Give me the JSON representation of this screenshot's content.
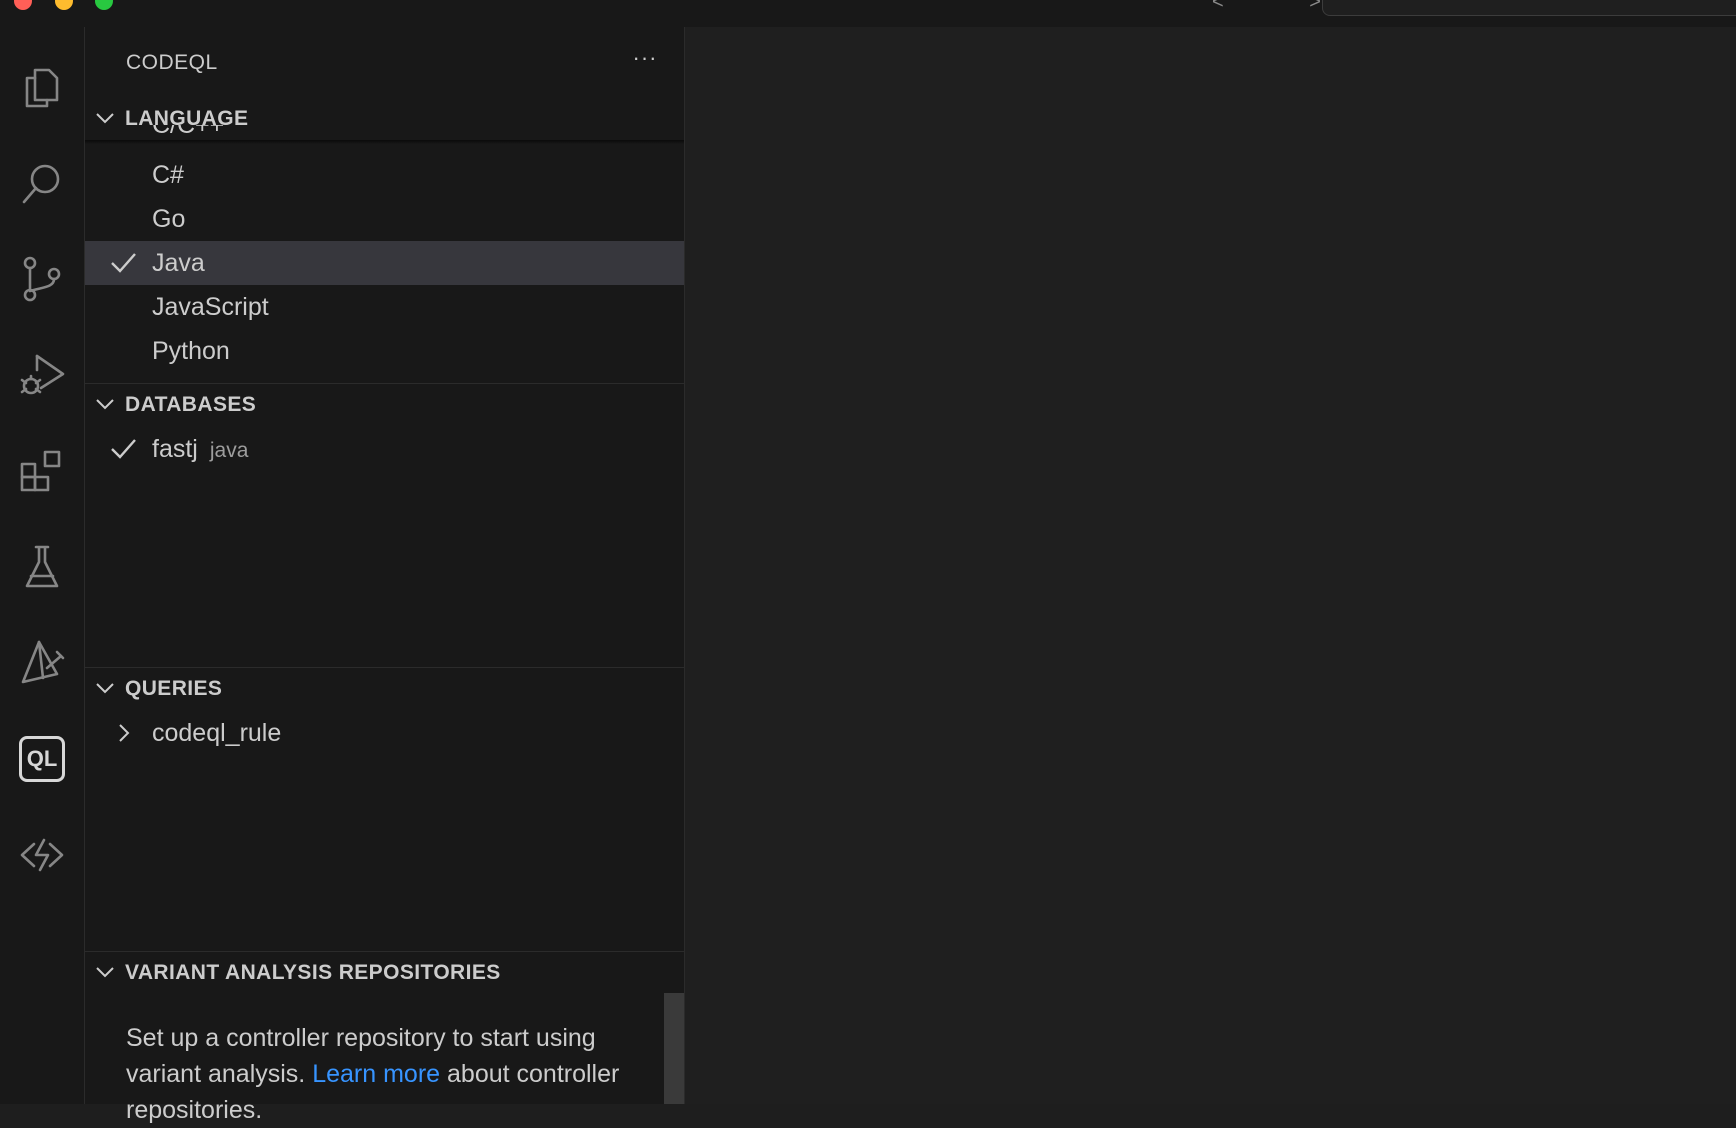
{
  "window": {
    "nav_arrows": "< >"
  },
  "sidebar": {
    "title": "CODEQL",
    "more_label": "···",
    "language": {
      "header": "LANGUAGE",
      "peek_text": "C/C++",
      "items": [
        {
          "label": "C#",
          "selected": false
        },
        {
          "label": "Go",
          "selected": false
        },
        {
          "label": "Java",
          "selected": true
        },
        {
          "label": "JavaScript",
          "selected": false
        },
        {
          "label": "Python",
          "selected": false
        }
      ]
    },
    "databases": {
      "header": "DATABASES",
      "items": [
        {
          "label": "fastj",
          "description": "java",
          "selected": true
        }
      ]
    },
    "queries": {
      "header": "QUERIES",
      "items": [
        {
          "label": "codeql_rule"
        }
      ]
    },
    "variant_analysis": {
      "header": "VARIANT ANALYSIS REPOSITORIES",
      "message_before": "Set up a controller repository to start using variant analysis. ",
      "link": "Learn more",
      "message_after": " about controller repositories."
    }
  },
  "activity_bar": {
    "icons": [
      "explorer-icon",
      "search-icon",
      "source-control-icon",
      "run-debug-icon",
      "extensions-icon",
      "testing-icon",
      "ai-toolkit-icon",
      "codeql-icon",
      "remote-icon"
    ],
    "active": "codeql-icon",
    "codeql_text": "QL"
  },
  "colors": {
    "background": "#1e1e1e",
    "sidebar": "#181818",
    "selection": "#37373d",
    "link": "#3794ff"
  }
}
